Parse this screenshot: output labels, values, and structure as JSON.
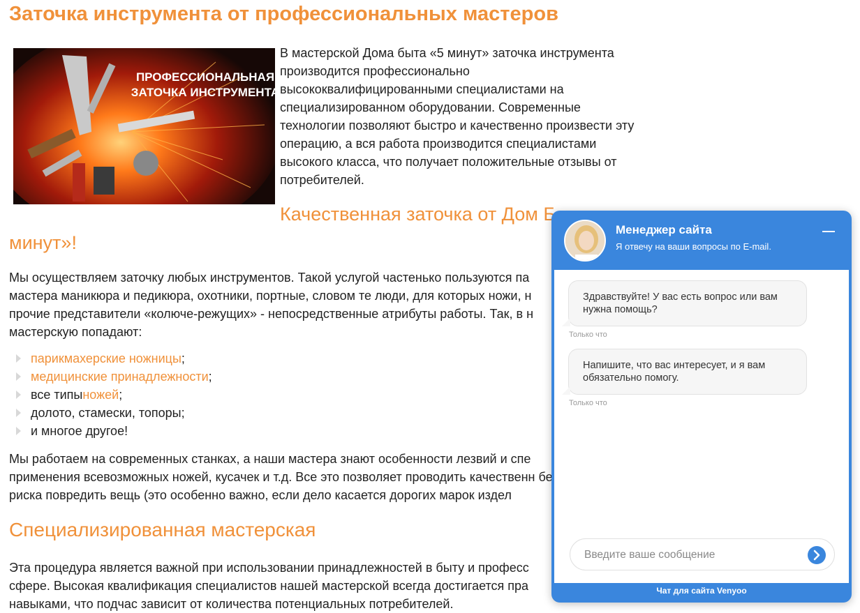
{
  "article": {
    "title": "Заточка инструмента от профессиональных мастеров",
    "hero_caption_line1": "ПРОФЕССИОНАЛЬНАЯ",
    "hero_caption_line2": "ЗАТОЧКА ИНСТРУМЕНТА",
    "intro": " В мастерской Дома быта «5 минут» заточка инструмента производится профессионально высококвалифицированными специалистами на специализированном оборудовании. Современные технологии позволяют быстро и качественно произвести эту операцию, а вся работа производится специалистами высокого класса, что получает положительные отзывы от потребителей.",
    "subtitle_a": "Качественная заточка от Дом Б",
    "subtitle_b": "минут»!",
    "para1": "Мы осуществляем заточку любых инструментов. Такой услугой частенько пользуются па мастера маникюра и педикюра, охотники, портные, словом те люди, для которых ножи, н прочие представители «колюче-режущих» - непосредственные атрибуты работы. Так, в н мастерскую попадают:",
    "list": [
      {
        "link": "парикмахерские ножницы",
        "pre": "",
        "post": ";"
      },
      {
        "link": "медицинские принадлежности",
        "pre": "",
        "post": ";"
      },
      {
        "link": "ножей",
        "pre": "все типы ",
        "post": ";"
      },
      {
        "link": "",
        "pre": "долото, стамески, топоры;",
        "post": ""
      },
      {
        "link": "",
        "pre": "и многое другое!",
        "post": ""
      }
    ],
    "para2": "Мы работаем на современных станках, а наши мастера знают особенности лезвий и спе применения всевозможных ножей, кусачек и т.д. Все это позволяет проводить качественн без риска повредить вещь (это особенно важно, если дело касается дорогих марок издел",
    "section_title": "Специализированная мастерская",
    "para3": "Эта процедура является важной при использовании принадлежностей в быту и професс сфере. Высокая квалификация специалистов нашей мастерской всегда достигается пра навыками, что подчас зависит от количества потенциальных потребителей."
  },
  "chat": {
    "manager_name": "Менеджер сайта",
    "manager_subtitle": "Я отвечу на ваши вопросы по E-mail.",
    "messages": [
      {
        "text": "Здравствуйте! У вас есть вопрос или вам нужна помощь?",
        "time": "Только что"
      },
      {
        "text": "Напишите, что вас интересует, и я вам обязательно помогу.",
        "time": "Только что"
      }
    ],
    "input_placeholder": "Введите ваше сообщение",
    "footer": "Чат для сайта Venyoo"
  },
  "icons": {
    "minimize": "minimize-icon",
    "send": "send-arrow-icon",
    "bullet": "triangle-bullet-icon"
  },
  "colors": {
    "accent_orange": "#f0913a",
    "chat_blue": "#3a86dd"
  }
}
